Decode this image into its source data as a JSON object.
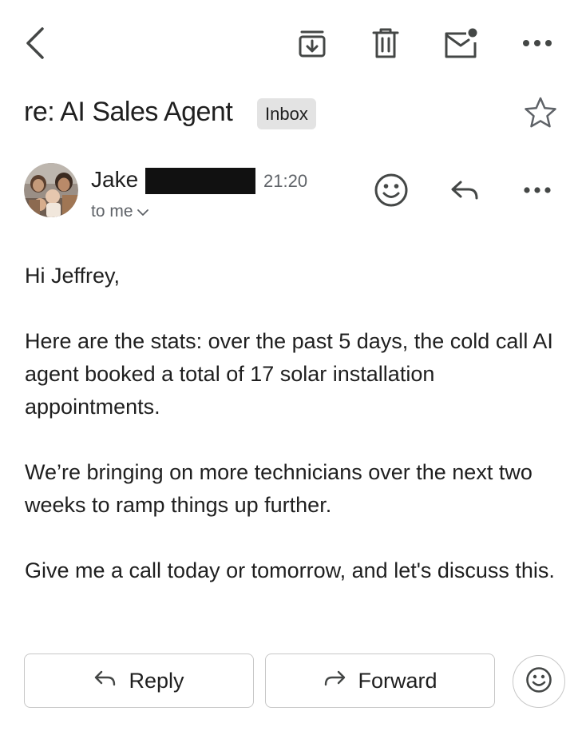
{
  "toolbar": {
    "icons": [
      "back-arrow-icon",
      "archive-icon",
      "trash-icon",
      "mark-unread-icon",
      "more-horizontal-icon"
    ]
  },
  "thread": {
    "subject": "re: AI Sales Agent",
    "label": "Inbox",
    "starred": false
  },
  "message": {
    "sender_first_name": "Jake",
    "sender_last_name_redacted": true,
    "time": "21:20",
    "recipient": "to me",
    "body": [
      "Hi Jeffrey,",
      "Here are the stats: over the past 5 days, the cold call AI agent booked a total of 17 solar installation appointments.",
      "We’re bringing on more technicians over the next two weeks to ramp things up further.",
      "Give me a call today or tomorrow, and let's discuss this."
    ]
  },
  "actions": {
    "reply_label": "Reply",
    "forward_label": "Forward"
  },
  "colors": {
    "text": "#1f1f1f",
    "secondary_text": "#5f6368",
    "icon": "#444746",
    "chip_bg": "#e3e3e3",
    "border": "#c7c7c7",
    "redaction": "#111111"
  }
}
